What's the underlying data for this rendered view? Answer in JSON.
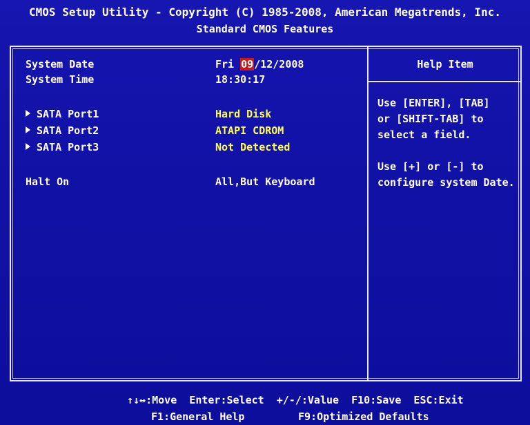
{
  "header": {
    "title": "CMOS Setup Utility - Copyright (C) 1985-2008, American Megatrends, Inc.",
    "subtitle": "Standard CMOS Features"
  },
  "settings": {
    "system_date": {
      "label": "System Date",
      "day": "Fri",
      "month": "09",
      "rest": "/12/2008"
    },
    "system_time": {
      "label": "System Time",
      "value": "18:30:17"
    },
    "sata_ports": [
      {
        "label": "SATA Port1",
        "value": "Hard Disk"
      },
      {
        "label": "SATA Port2",
        "value": "ATAPI CDROM"
      },
      {
        "label": "SATA Port3",
        "value": "Not Detected"
      }
    ],
    "halt_on": {
      "label": "Halt On",
      "value": "All,But Keyboard"
    }
  },
  "help": {
    "title": "Help Item",
    "text": "Use [ENTER], [TAB]\nor [SHIFT-TAB] to\nselect a field.\n\nUse [+] or [-] to\nconfigure system Date."
  },
  "footer": {
    "line1": "↑↓↔:Move  Enter:Select  +/-/:Value  F10:Save  ESC:Exit",
    "line2_left": "F1:General Help",
    "line2_right": "F9:Optimized Defaults"
  },
  "colors": {
    "background": "#1111a8",
    "text": "#ffffff",
    "value_highlight": "#ffff40",
    "selected_field": "#c81818"
  },
  "icons": {
    "submenu": "right-triangle-icon"
  }
}
